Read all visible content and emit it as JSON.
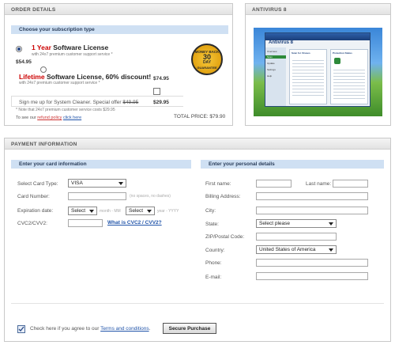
{
  "order": {
    "header": "ORDER DETAILS",
    "subheader": "Choose your subscription type",
    "option1": {
      "title_emph": "1 Year",
      "title_rest": " Software License",
      "desc": "with 24x7 premium customer support service *",
      "price": "$54.95",
      "selected": true
    },
    "option2": {
      "title_emph": "Lifetime",
      "title_rest": " Software License, 60% discount!",
      "desc": "with 24x7 premium customer support service *",
      "price": "$74.95",
      "selected": false
    },
    "badge": {
      "line1": "MONEY BACK",
      "line2": "30",
      "line3": "DAY",
      "line4": "GUARANTEE"
    },
    "cleaner": {
      "text": "Sign me up for System Cleaner. Special offer",
      "old_price": "$49.95",
      "price": "$29.95",
      "note": "* Note that 24x7 premium customer service costs $29.95"
    },
    "refund": {
      "prefix": "To see our",
      "policy_link": "refund policy",
      "click_link": "click here"
    },
    "total": "TOTAL PRICE: $79.90"
  },
  "antivirus": {
    "header": "ANTIVIRUS 8",
    "screenshot": {
      "app_name": "Antivirus 8",
      "left_items": [
        "Overview",
        "Scan",
        "Update",
        "Settings",
        "Help"
      ],
      "panel1_title": "Scan for Viruses",
      "panel2_title": "Protection Status"
    }
  },
  "payment": {
    "header": "PAYMENT INFORMATION",
    "card_section": "Enter your card information",
    "personal_section": "Enter your personal details",
    "card_type_label": "Select Card Type:",
    "card_type_value": "VISA",
    "card_number_label": "Card Number:",
    "card_number_hint": "(no spaces, no dashes)",
    "expiration_label": "Expiration date:",
    "month_value": "Select",
    "month_hint": "month - MM",
    "year_value": "Select",
    "year_hint": "year - YYYY",
    "cvc_label": "CVC2/CVV2:",
    "cvc_link": "What is CVC2 / CVV2?",
    "first_name_label": "First name:",
    "last_name_label": "Last name:",
    "billing_label": "Billing Address:",
    "city_label": "City:",
    "state_label": "State:",
    "state_value": "Select please",
    "zip_label": "ZIP/Postal Code:",
    "country_label": "Country:",
    "country_value": "United States of America",
    "phone_label": "Phone:",
    "email_label": "E-mail:",
    "agree_prefix": "Check here if you agree to our",
    "terms_link": "Terms and conditions",
    "agree_suffix": ".",
    "agree_checked": true,
    "submit_label": "Secure Purchase"
  }
}
